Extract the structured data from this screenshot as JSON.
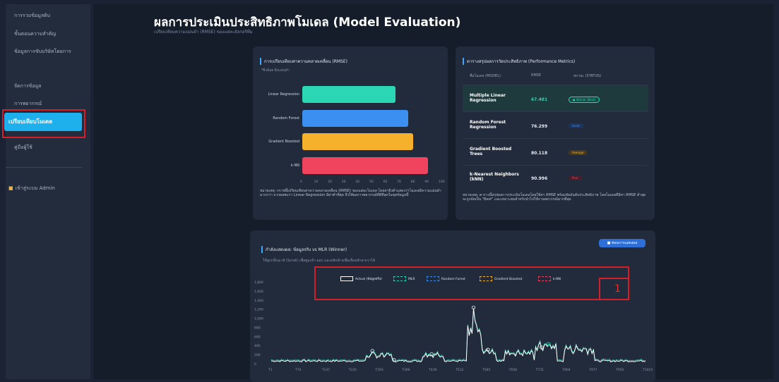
{
  "sidebar": {
    "items": [
      {
        "label": "การรวมข้อมูลดิบ"
      },
      {
        "label": "ขั้นตอนความสำคัญ"
      },
      {
        "label": "ข้อมูลการขับบริษัทโดยการ"
      },
      {
        "label": "จัดการข้อมูล"
      },
      {
        "label": "การพยากรณ์"
      },
      {
        "label": "เปรียบเทียบโมเดล"
      },
      {
        "label": "คู่มือผู้ใช้"
      }
    ],
    "active_index": 5,
    "admin_label": "เข้าสู่ระบบ Admin",
    "admin_icon": "lock-icon"
  },
  "header": {
    "title": "ผลการประเมินประสิทธิภาพโมเดล (Model Evaluation)",
    "subtitle": "เปรียบเทียบความแม่นยำ (RMSE) ของแต่ละอัลกอริทึม"
  },
  "rmse_card": {
    "title": "การเปรียบเทียบค่าความคลาดเคลื่อน (RMSE)",
    "subtitle": "*ยิ่งน้อย ยิ่งแม่นยำ",
    "note": "หมายเหตุ: กราฟนี้เปรียบเทียบค่าความคลาดเคลื่อน (RMSE) ของแต่ละโมเดล โดยค่ายิ่งต่ำแสดงว่าโมเดลมีความแม่นยำมากกว่า จากผลพบว่า Linear Regression มีค่าต่ำที่สุด จึงให้ผลการพยากรณ์ที่ดีที่สุดในชุดข้อมูลนี้"
  },
  "chart_data": {
    "type": "bar",
    "orientation": "horizontal",
    "categories": [
      "Linear Regression",
      "Random Forest",
      "Gradient Boosted",
      "k-NN"
    ],
    "values": [
      67.481,
      76.299,
      80.118,
      90.996
    ],
    "colors": [
      "#2bd6b4",
      "#3b8ff0",
      "#f5b12b",
      "#f0435e"
    ],
    "xticks": [
      "0",
      "10",
      "20",
      "30",
      "40",
      "50",
      "60",
      "70",
      "80",
      "90",
      "100"
    ],
    "xlim": [
      0,
      100
    ]
  },
  "metrics_card": {
    "title": "ตารางสรุปผลการวัดประสิทธิภาพ (Performance Metrics)",
    "headers": [
      "ชื่อโมเดล (MODEL)",
      "RMSE",
      "สถานะ (STATUS)"
    ],
    "rows": [
      {
        "model": "Multiple Linear Regression",
        "rmse": "67.481",
        "status": "● Winner (Best)",
        "status_color": "#2bd6b4"
      },
      {
        "model": "Random Forest Regression",
        "rmse": "76.299",
        "status": "Good",
        "status_color": "#3b8ff0"
      },
      {
        "model": "Gradient Boosted Trees",
        "rmse": "80.118",
        "status": "Average",
        "status_color": "#f5b12b"
      },
      {
        "model": "k-Nearest Neighbors (kNN)",
        "rmse": "90.996",
        "status": "Poor",
        "status_color": "#f0435e"
      }
    ],
    "note": "หมายเหตุ: ตารางนี้สรุปผลการประเมินโมเดลโดยใช้ค่า RMSE พร้อมจัดอันดับประสิทธิภาพ โดยโมเดลที่มีค่า RMSE ต่ำสุดจะถูกจัดเป็น \"Best\" และเหมาะสมสำหรับนำไปใช้งานพยากรณ์มากที่สุด"
  },
  "forecast_card": {
    "title": "กำลังแสดงผล: ข้อมูลจริง vs MLR (Winner)",
    "subtitle": "ใช้ลูกกลิ้งเมาส์ (Scroll) เพื่อซูมเข้า-ออก และคลิกค้างเพื่อเลื่อนซ้าย-ขวาได้",
    "button_label": "■ ซ่อนการแสดงผล",
    "legend": [
      "Actual (ข้อมูลจริง)",
      "MLR",
      "Random Forest",
      "Gradient Boosted",
      "k-NN"
    ],
    "legend_colors": [
      "#ffffff",
      "#2bd6b4",
      "#3b8ff0",
      "#f5b12b",
      "#f0435e"
    ],
    "yticks": [
      "1,800",
      "1,600",
      "1,400",
      "1,200",
      "1,000",
      "800",
      "600",
      "400",
      "200",
      "0"
    ],
    "xticks": [
      "T1",
      "T74",
      "T147",
      "T220",
      "T293",
      "T366",
      "T439",
      "T512",
      "T585",
      "T658",
      "T731",
      "T804",
      "T877",
      "T950",
      "T1023"
    ]
  },
  "annotations": {
    "legend_box_label": "1"
  }
}
